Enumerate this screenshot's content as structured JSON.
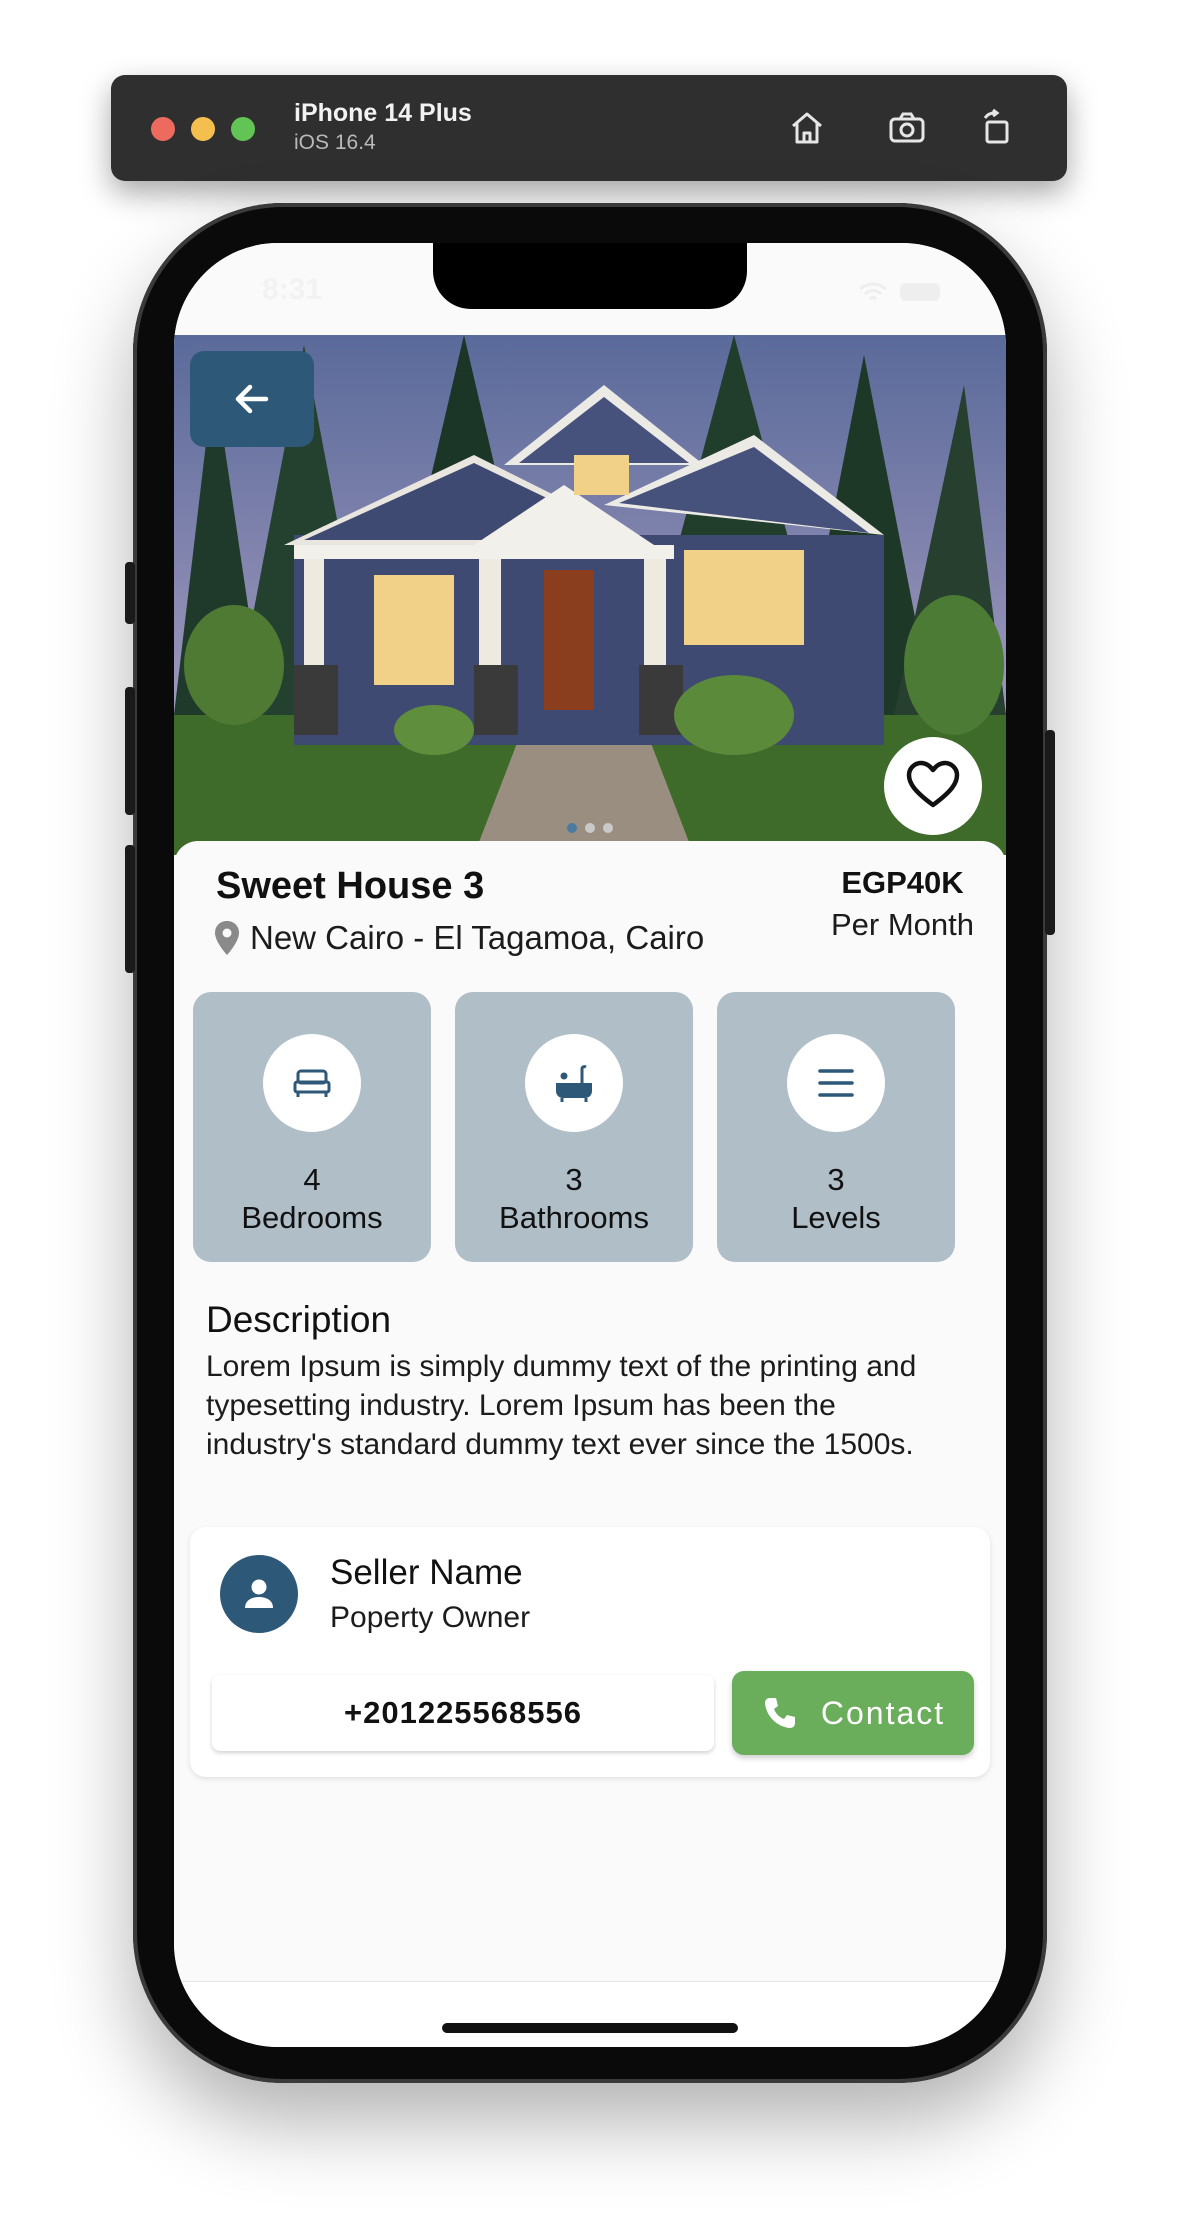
{
  "simulator": {
    "device_name": "iPhone 14 Plus",
    "os_version": "iOS 16.4"
  },
  "status_bar": {
    "time": "8:31"
  },
  "listing": {
    "title": "Sweet House 3",
    "location": "New Cairo - El Tagamoa, Cairo",
    "price": "EGP40K",
    "price_period": "Per Month",
    "image_page_indicator": {
      "total": 3,
      "active": 1
    }
  },
  "features": [
    {
      "count": "4",
      "label": "Bedrooms",
      "icon": "bed-icon"
    },
    {
      "count": "3",
      "label": "Bathrooms",
      "icon": "bathtub-icon"
    },
    {
      "count": "3",
      "label": "Levels",
      "icon": "menu-lines-icon"
    }
  ],
  "description": {
    "heading": "Description",
    "text": "Lorem Ipsum is simply dummy text of the printing and typesetting industry. Lorem Ipsum has been the industry's standard dummy text ever since the 1500s."
  },
  "seller": {
    "name": "Seller Name",
    "role": "Poperty Owner",
    "phone": "+201225568556",
    "contact_label": "Contact"
  },
  "colors": {
    "primary": "#2e5877",
    "feature_card": "#b0bec7",
    "contact_green": "#6aad5b",
    "background": "#fafafa"
  }
}
